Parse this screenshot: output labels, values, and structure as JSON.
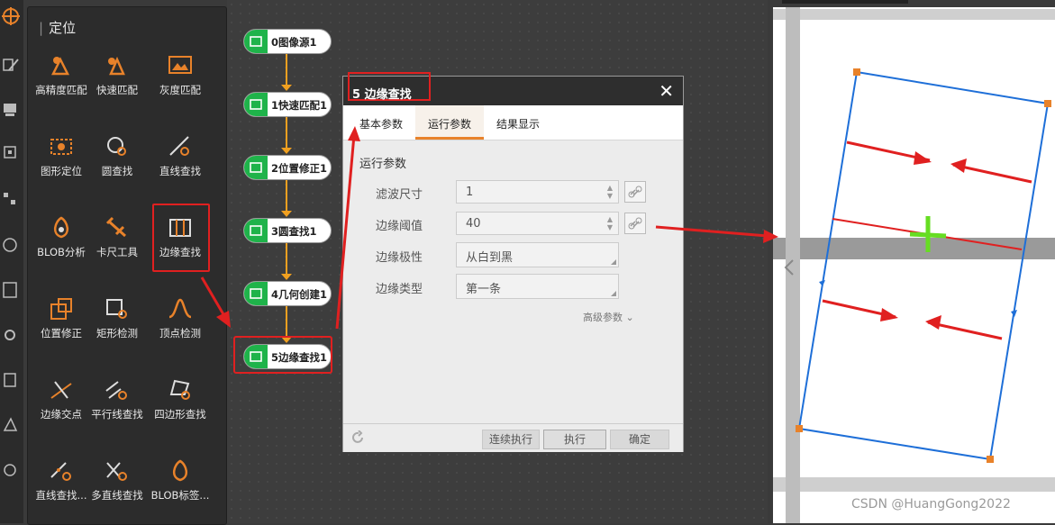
{
  "panel": {
    "title": "定位"
  },
  "tools": [
    {
      "id": "t1",
      "label": "高精度匹配",
      "icon": "high-precision-match-icon"
    },
    {
      "id": "t2",
      "label": "快速匹配",
      "icon": "fast-match-icon"
    },
    {
      "id": "t3",
      "label": "灰度匹配",
      "icon": "gray-match-icon"
    },
    {
      "id": "t4",
      "label": "图形定位",
      "icon": "shape-locate-icon"
    },
    {
      "id": "t5",
      "label": "圆查找",
      "icon": "circle-find-icon"
    },
    {
      "id": "t6",
      "label": "直线查找",
      "icon": "line-find-icon"
    },
    {
      "id": "t7",
      "label": "BLOB分析",
      "icon": "blob-analysis-icon"
    },
    {
      "id": "t8",
      "label": "卡尺工具",
      "icon": "caliper-tool-icon"
    },
    {
      "id": "t9",
      "label": "边缘查找",
      "icon": "edge-find-icon"
    },
    {
      "id": "t10",
      "label": "位置修正",
      "icon": "position-correct-icon"
    },
    {
      "id": "t11",
      "label": "矩形检测",
      "icon": "rect-detect-icon"
    },
    {
      "id": "t12",
      "label": "顶点检测",
      "icon": "peak-detect-icon"
    },
    {
      "id": "t13",
      "label": "边缘交点",
      "icon": "edge-intersect-icon"
    },
    {
      "id": "t14",
      "label": "平行线查找",
      "icon": "parallel-line-icon"
    },
    {
      "id": "t15",
      "label": "四边形查找",
      "icon": "quad-find-icon"
    },
    {
      "id": "t16",
      "label": "直线查找...",
      "icon": "line-find-multi-icon"
    },
    {
      "id": "t17",
      "label": "多直线查找",
      "icon": "multi-line-icon"
    },
    {
      "id": "t18",
      "label": "BLOB标签...",
      "icon": "blob-label-icon"
    }
  ],
  "flow": {
    "nodes": [
      {
        "label": "0图像源1",
        "icon": "image-source-icon"
      },
      {
        "label": "1快速匹配1",
        "icon": "fast-match-icon"
      },
      {
        "label": "2位置修正1",
        "icon": "position-correct-icon"
      },
      {
        "label": "3圆查找1",
        "icon": "circle-find-icon"
      },
      {
        "label": "4几何创建1",
        "icon": "geometry-create-icon"
      },
      {
        "label": "5边缘查找1",
        "icon": "edge-find-icon"
      }
    ]
  },
  "dialog": {
    "title": "5 边缘查找",
    "close": "✕",
    "tabs": [
      "基本参数",
      "运行参数",
      "结果显示"
    ],
    "active_tab": "运行参数",
    "section": "运行参数",
    "fields": [
      {
        "label": "滤波尺寸",
        "value": "1",
        "type": "spin"
      },
      {
        "label": "边缘阈值",
        "value": "40",
        "type": "spin"
      },
      {
        "label": "边缘极性",
        "value": "从白到黑",
        "type": "select"
      },
      {
        "label": "边缘类型",
        "value": "第一条",
        "type": "select"
      }
    ],
    "advanced": "高级参数",
    "buttons": {
      "continuous": "连续执行",
      "run": "执行",
      "ok": "确定"
    }
  },
  "watermark": "CSDN @HuangGong2022",
  "colors": {
    "accent": "#e8822a",
    "highlight": "#e02020",
    "node_green": "#1fb34a",
    "flow_line": "#f0a020",
    "roi_blue": "#1e6fd8",
    "cross_green": "#66dd22"
  }
}
